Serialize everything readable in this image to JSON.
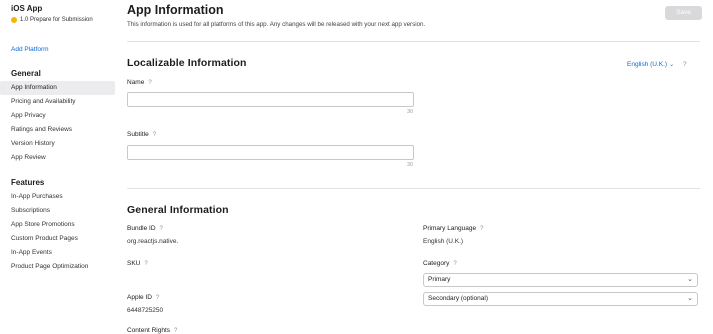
{
  "sidebar": {
    "app_title": "iOS App",
    "status": "1.0 Prepare for Submission",
    "status_color": "#f4b400",
    "add_platform": "Add Platform",
    "general": {
      "heading": "General",
      "items": [
        {
          "label": "App Information",
          "active": true
        },
        {
          "label": "Pricing and Availability"
        },
        {
          "label": "App Privacy"
        },
        {
          "label": "Ratings and Reviews"
        },
        {
          "label": "Version History"
        },
        {
          "label": "App Review"
        }
      ]
    },
    "features": {
      "heading": "Features",
      "items": [
        {
          "label": "In-App Purchases"
        },
        {
          "label": "Subscriptions"
        },
        {
          "label": "App Store Promotions"
        },
        {
          "label": "Custom Product Pages"
        },
        {
          "label": "In-App Events"
        },
        {
          "label": "Product Page Optimization"
        }
      ]
    }
  },
  "header": {
    "title": "App Information",
    "description": "This information is used for all platforms of this app. Any changes will be released with your next app version.",
    "save_label": "Save"
  },
  "localizable": {
    "title": "Localizable Information",
    "language": "English (U.K.)",
    "help": "?",
    "name_label": "Name",
    "name_value": "",
    "name_count": "30",
    "subtitle_label": "Subtitle",
    "subtitle_value": "",
    "subtitle_count": "30"
  },
  "general_info": {
    "title": "General Information",
    "bundle_id_label": "Bundle ID",
    "bundle_id_value": "org.reactjs.native.",
    "sku_label": "SKU",
    "apple_id_label": "Apple ID",
    "apple_id_value": "6448725250",
    "content_rights_label": "Content Rights",
    "primary_language_label": "Primary Language",
    "primary_language_value": "English (U.K.)",
    "category_label": "Category",
    "category_primary": "Primary",
    "category_secondary": "Secondary (optional)",
    "help": "?"
  },
  "icons": {
    "status": "status-dot-icon",
    "help": "question-mark-icon",
    "dropdown": "chevron-down-icon"
  },
  "colors": {
    "link": "#0a6bd6",
    "save_disabled": "#d9d9dc",
    "active_nav": "#ececef"
  }
}
